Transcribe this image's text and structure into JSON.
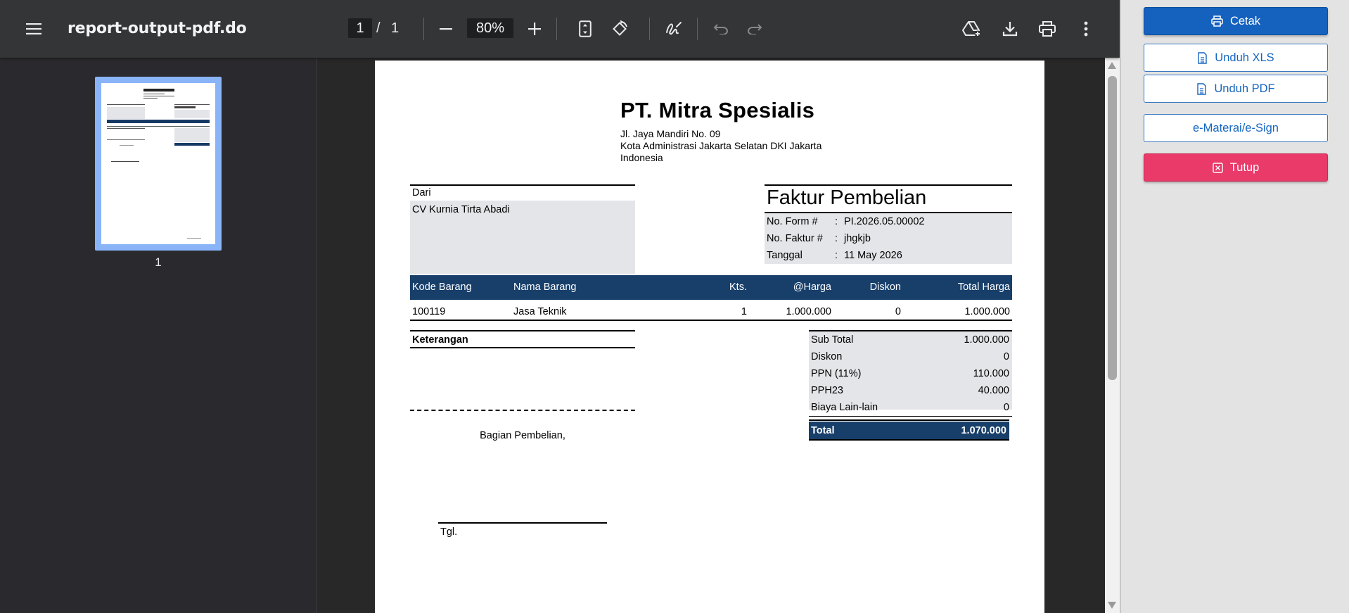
{
  "viewer": {
    "doc_title": "report-output-pdf.do",
    "current_page": "1",
    "page_separator": "/",
    "total_pages": "1",
    "zoom": "80%",
    "thumbnail_label": "1"
  },
  "invoice": {
    "company": {
      "name": "PT. Mitra Spesialis",
      "address_line1": "Jl. Jaya Mandiri No. 09",
      "address_line2": "Kota Administrasi Jakarta Selatan DKI Jakarta",
      "address_line3": "Indonesia"
    },
    "from_label": "Dari",
    "supplier": "CV Kurnia Tirta Abadi",
    "doc_title": "Faktur Pembelian",
    "meta": [
      {
        "label": "No. Form #",
        "sep": ":",
        "value": "PI.2026.05.00002"
      },
      {
        "label": "No. Faktur #",
        "sep": ":",
        "value": "jhgkjb"
      },
      {
        "label": "Tanggal",
        "sep": ":",
        "value": "11 May 2026"
      }
    ],
    "table": {
      "headers": [
        "Kode Barang",
        "Nama Barang",
        "Kts.",
        "@Harga",
        "Diskon",
        "Total Harga"
      ],
      "rows": [
        [
          "100119",
          "Jasa Teknik",
          "1",
          "1.000.000",
          "0",
          "1.000.000"
        ]
      ]
    },
    "notes_label": "Keterangan",
    "signature_label": "Bagian Pembelian,",
    "date_label": "Tgl.",
    "summary": [
      {
        "label": "Sub Total",
        "value": "1.000.000"
      },
      {
        "label": "Diskon",
        "value": "0"
      },
      {
        "label": "PPN (11%)",
        "value": "110.000"
      },
      {
        "label": "PPH23",
        "value": "40.000"
      },
      {
        "label": "Biaya Lain-lain",
        "value": "0"
      }
    ],
    "total_label": "Total",
    "total_value": "1.070.000"
  },
  "actions": {
    "print": "Cetak",
    "download_xls": "Unduh XLS",
    "download_pdf": "Unduh PDF",
    "esign": "e-Materai/e-Sign",
    "close": "Tutup"
  },
  "colors": {
    "table_header": "#183f6a",
    "primary_button": "#1561be",
    "danger_button": "#e93a6a",
    "viewer_toolbar": "#333536"
  },
  "icons": [
    "menu-icon",
    "minus-icon",
    "plus-icon",
    "fit-page-icon",
    "rotate-icon",
    "draw-icon",
    "undo-icon",
    "redo-icon",
    "drive-icon",
    "download-icon",
    "print-icon",
    "more-icon",
    "printer-icon",
    "file-icon",
    "close-box-icon"
  ]
}
